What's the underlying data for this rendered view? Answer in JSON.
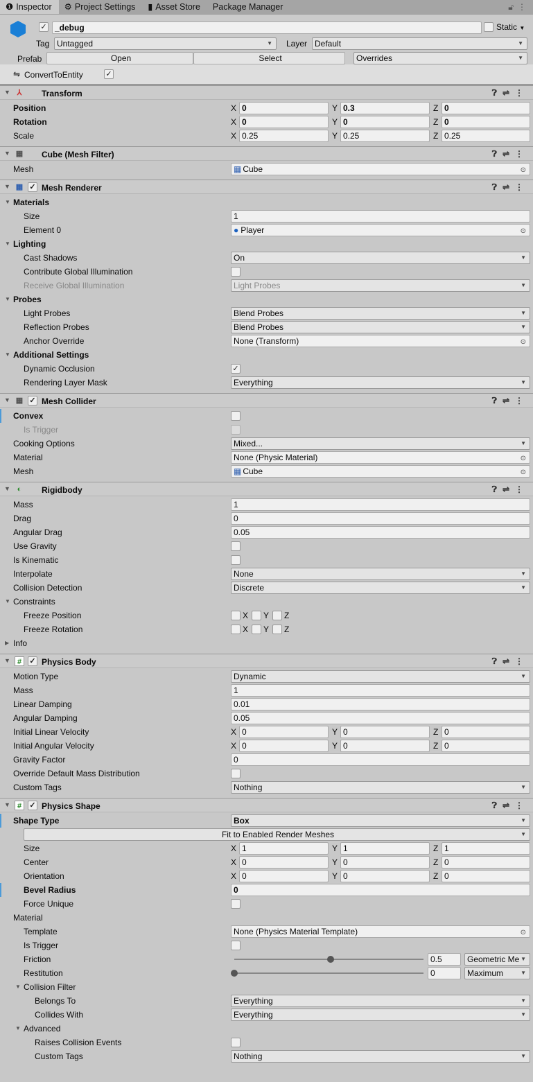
{
  "tabs": [
    {
      "label": "Inspector",
      "icon": "info-icon"
    },
    {
      "label": "Project Settings",
      "icon": "gear-icon"
    },
    {
      "label": "Asset Store",
      "icon": "bag-icon"
    },
    {
      "label": "Package Manager",
      "icon": ""
    }
  ],
  "gameobject": {
    "name": "_debug",
    "active": true,
    "static_label": "Static",
    "tag_label": "Tag",
    "tag": "Untagged",
    "layer_label": "Layer",
    "layer": "Default",
    "prefab_label": "Prefab",
    "open": "Open",
    "select": "Select",
    "overrides": "Overrides"
  },
  "convert": {
    "label": "ConvertToEntity",
    "checked": true
  },
  "components": [
    {
      "title": "Transform",
      "icon": "transform-icon",
      "toggle": false,
      "rows": [
        {
          "label": "Position",
          "bold": true,
          "type": "vec3",
          "values": [
            "0",
            "0.3",
            "0"
          ]
        },
        {
          "label": "Rotation",
          "bold": true,
          "type": "vec3",
          "values": [
            "0",
            "0",
            "0"
          ]
        },
        {
          "label": "Scale",
          "type": "vec3",
          "values": [
            "0.25",
            "0.25",
            "0.25"
          ]
        }
      ]
    },
    {
      "title": "Cube (Mesh Filter)",
      "icon": "mesh-filter-icon",
      "toggle": false,
      "rows": [
        {
          "label": "Mesh",
          "type": "object",
          "value": "Cube",
          "oicon": "mesh"
        }
      ]
    },
    {
      "title": "Mesh Renderer",
      "icon": "mesh-renderer-icon",
      "toggle": true,
      "rows": [
        {
          "label": "Materials",
          "bold": true,
          "fold": true
        },
        {
          "label": "Size",
          "indent": 1,
          "type": "text",
          "value": "1"
        },
        {
          "label": "Element 0",
          "indent": 1,
          "type": "object",
          "value": "Player",
          "oicon": "material"
        },
        {
          "label": "Lighting",
          "bold": true,
          "fold": true
        },
        {
          "label": "Cast Shadows",
          "indent": 1,
          "type": "dropdown",
          "value": "On"
        },
        {
          "label": "Contribute Global Illumination",
          "indent": 1,
          "type": "check",
          "checked": false
        },
        {
          "label": "Receive Global Illumination",
          "indent": 1,
          "dis": true,
          "type": "dropdown",
          "value": "Light Probes"
        },
        {
          "label": "Probes",
          "bold": true,
          "fold": true
        },
        {
          "label": "Light Probes",
          "indent": 1,
          "type": "dropdown",
          "value": "Blend Probes"
        },
        {
          "label": "Reflection Probes",
          "indent": 1,
          "type": "dropdown",
          "value": "Blend Probes"
        },
        {
          "label": "Anchor Override",
          "indent": 1,
          "type": "object",
          "value": "None (Transform)"
        },
        {
          "label": "Additional Settings",
          "bold": true,
          "fold": true
        },
        {
          "label": "Dynamic Occlusion",
          "indent": 1,
          "type": "check",
          "checked": true
        },
        {
          "label": "Rendering Layer Mask",
          "indent": 1,
          "type": "dropdown",
          "value": "Everything"
        }
      ]
    },
    {
      "title": "Mesh Collider",
      "icon": "mesh-collider-icon",
      "toggle": true,
      "rows": [
        {
          "label": "Convex",
          "bold": true,
          "mod": true,
          "type": "check",
          "checked": false
        },
        {
          "label": "Is Trigger",
          "indent": 1,
          "dis": true,
          "type": "check",
          "checked": false
        },
        {
          "label": "Cooking Options",
          "type": "dropdown",
          "value": "Mixed..."
        },
        {
          "label": "Material",
          "type": "object",
          "value": "None (Physic Material)"
        },
        {
          "label": "Mesh",
          "type": "object",
          "value": "Cube",
          "oicon": "mesh"
        }
      ]
    },
    {
      "title": "Rigidbody",
      "icon": "rigidbody-icon",
      "toggle": false,
      "rows": [
        {
          "label": "Mass",
          "type": "text",
          "value": "1"
        },
        {
          "label": "Drag",
          "type": "text",
          "value": "0"
        },
        {
          "label": "Angular Drag",
          "type": "text",
          "value": "0.05"
        },
        {
          "label": "Use Gravity",
          "type": "check",
          "checked": false
        },
        {
          "label": "Is Kinematic",
          "type": "check",
          "checked": false
        },
        {
          "label": "Interpolate",
          "type": "dropdown",
          "value": "None"
        },
        {
          "label": "Collision Detection",
          "type": "dropdown",
          "value": "Discrete"
        },
        {
          "label": "Constraints",
          "fold": true
        },
        {
          "label": "Freeze Position",
          "indent": 1,
          "type": "xyzcheck"
        },
        {
          "label": "Freeze Rotation",
          "indent": 1,
          "type": "xyzcheck"
        },
        {
          "label": "Info",
          "fold": true,
          "closed": true
        }
      ]
    },
    {
      "title": "Physics Body",
      "icon": "script-icon",
      "toggle": true,
      "rows": [
        {
          "label": "Motion Type",
          "type": "dropdown",
          "value": "Dynamic"
        },
        {
          "label": "Mass",
          "type": "text",
          "value": "1"
        },
        {
          "label": "Linear Damping",
          "type": "text",
          "value": "0.01"
        },
        {
          "label": "Angular Damping",
          "type": "text",
          "value": "0.05"
        },
        {
          "label": "Initial Linear Velocity",
          "type": "vec3",
          "values": [
            "0",
            "0",
            "0"
          ]
        },
        {
          "label": "Initial Angular Velocity",
          "type": "vec3",
          "values": [
            "0",
            "0",
            "0"
          ]
        },
        {
          "label": "Gravity Factor",
          "type": "text",
          "value": "0"
        },
        {
          "label": "Override Default Mass Distribution",
          "type": "check",
          "checked": false
        },
        {
          "label": "Custom Tags",
          "type": "dropdown",
          "value": "Nothing"
        }
      ]
    },
    {
      "title": "Physics Shape",
      "icon": "script-icon",
      "toggle": true,
      "rows": [
        {
          "label": "Shape Type",
          "bold": true,
          "mod": true,
          "type": "dropdown",
          "value": "Box",
          "boldval": true
        },
        {
          "type": "widebutton",
          "value": "Fit to Enabled Render Meshes"
        },
        {
          "label": "Size",
          "indent": 1,
          "type": "vec3",
          "values": [
            "1",
            "1",
            "1"
          ]
        },
        {
          "label": "Center",
          "indent": 1,
          "type": "vec3",
          "values": [
            "0",
            "0",
            "0"
          ]
        },
        {
          "label": "Orientation",
          "indent": 1,
          "type": "vec3",
          "values": [
            "0",
            "0",
            "0"
          ]
        },
        {
          "label": "Bevel Radius",
          "indent": 1,
          "bold": true,
          "mod": true,
          "type": "text",
          "value": "0",
          "boldval": true
        },
        {
          "label": "Force Unique",
          "indent": 1,
          "type": "check",
          "checked": false
        },
        {
          "label": "Material"
        },
        {
          "label": "Template",
          "indent": 1,
          "type": "object",
          "value": "None (Physics Material Template)"
        },
        {
          "label": "Is Trigger",
          "indent": 1,
          "type": "check",
          "checked": false
        },
        {
          "label": "Friction",
          "indent": 1,
          "type": "slider",
          "value": "0.5",
          "fraction": 0.5,
          "mode": "Geometric Me"
        },
        {
          "label": "Restitution",
          "indent": 1,
          "type": "slider",
          "value": "0",
          "fraction": 0,
          "mode": "Maximum"
        },
        {
          "label": "Collision Filter",
          "indent": 1,
          "fold": true
        },
        {
          "label": "Belongs To",
          "indent": 2,
          "type": "dropdown",
          "value": "Everything"
        },
        {
          "label": "Collides With",
          "indent": 2,
          "type": "dropdown",
          "value": "Everything"
        },
        {
          "label": "Advanced",
          "indent": 1,
          "fold": true
        },
        {
          "label": "Raises Collision Events",
          "indent": 2,
          "type": "check",
          "checked": false
        },
        {
          "label": "Custom Tags",
          "indent": 2,
          "type": "dropdown",
          "value": "Nothing"
        }
      ]
    }
  ],
  "axes": [
    "X",
    "Y",
    "Z"
  ],
  "colors": {
    "accent": "#4c9ad8",
    "cube": "#1a7fd6"
  }
}
